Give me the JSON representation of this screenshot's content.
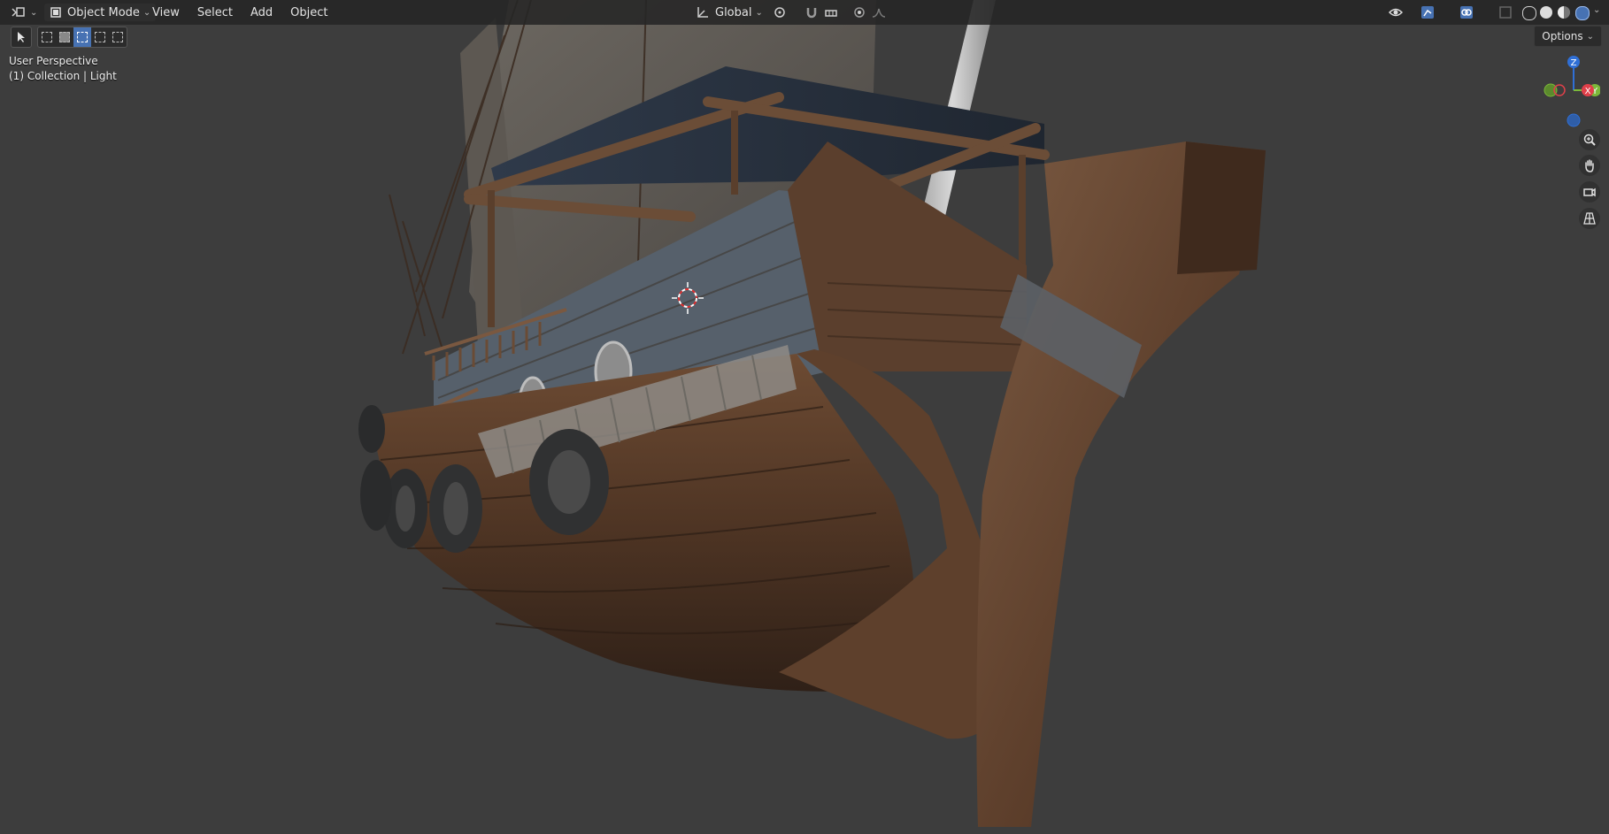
{
  "header": {
    "editor_type_icon": "3d-viewport-icon",
    "mode": "Object Mode",
    "menus": [
      "View",
      "Select",
      "Add",
      "Object"
    ],
    "orientation": "Global"
  },
  "toolbar": {
    "options_label": "Options"
  },
  "viewport": {
    "perspective_label": "User Perspective",
    "collection_label": "(1) Collection | Light"
  },
  "gizmo": {
    "z_label": "Z",
    "x_label": "X",
    "y_label": "Y"
  },
  "colors": {
    "x_axis": "#e0404a",
    "y_axis": "#7cb83a",
    "z_axis": "#2f6fd6",
    "selection": "#4772b3",
    "header_bg": "#252525",
    "viewport_bg": "#3d3d3d"
  }
}
